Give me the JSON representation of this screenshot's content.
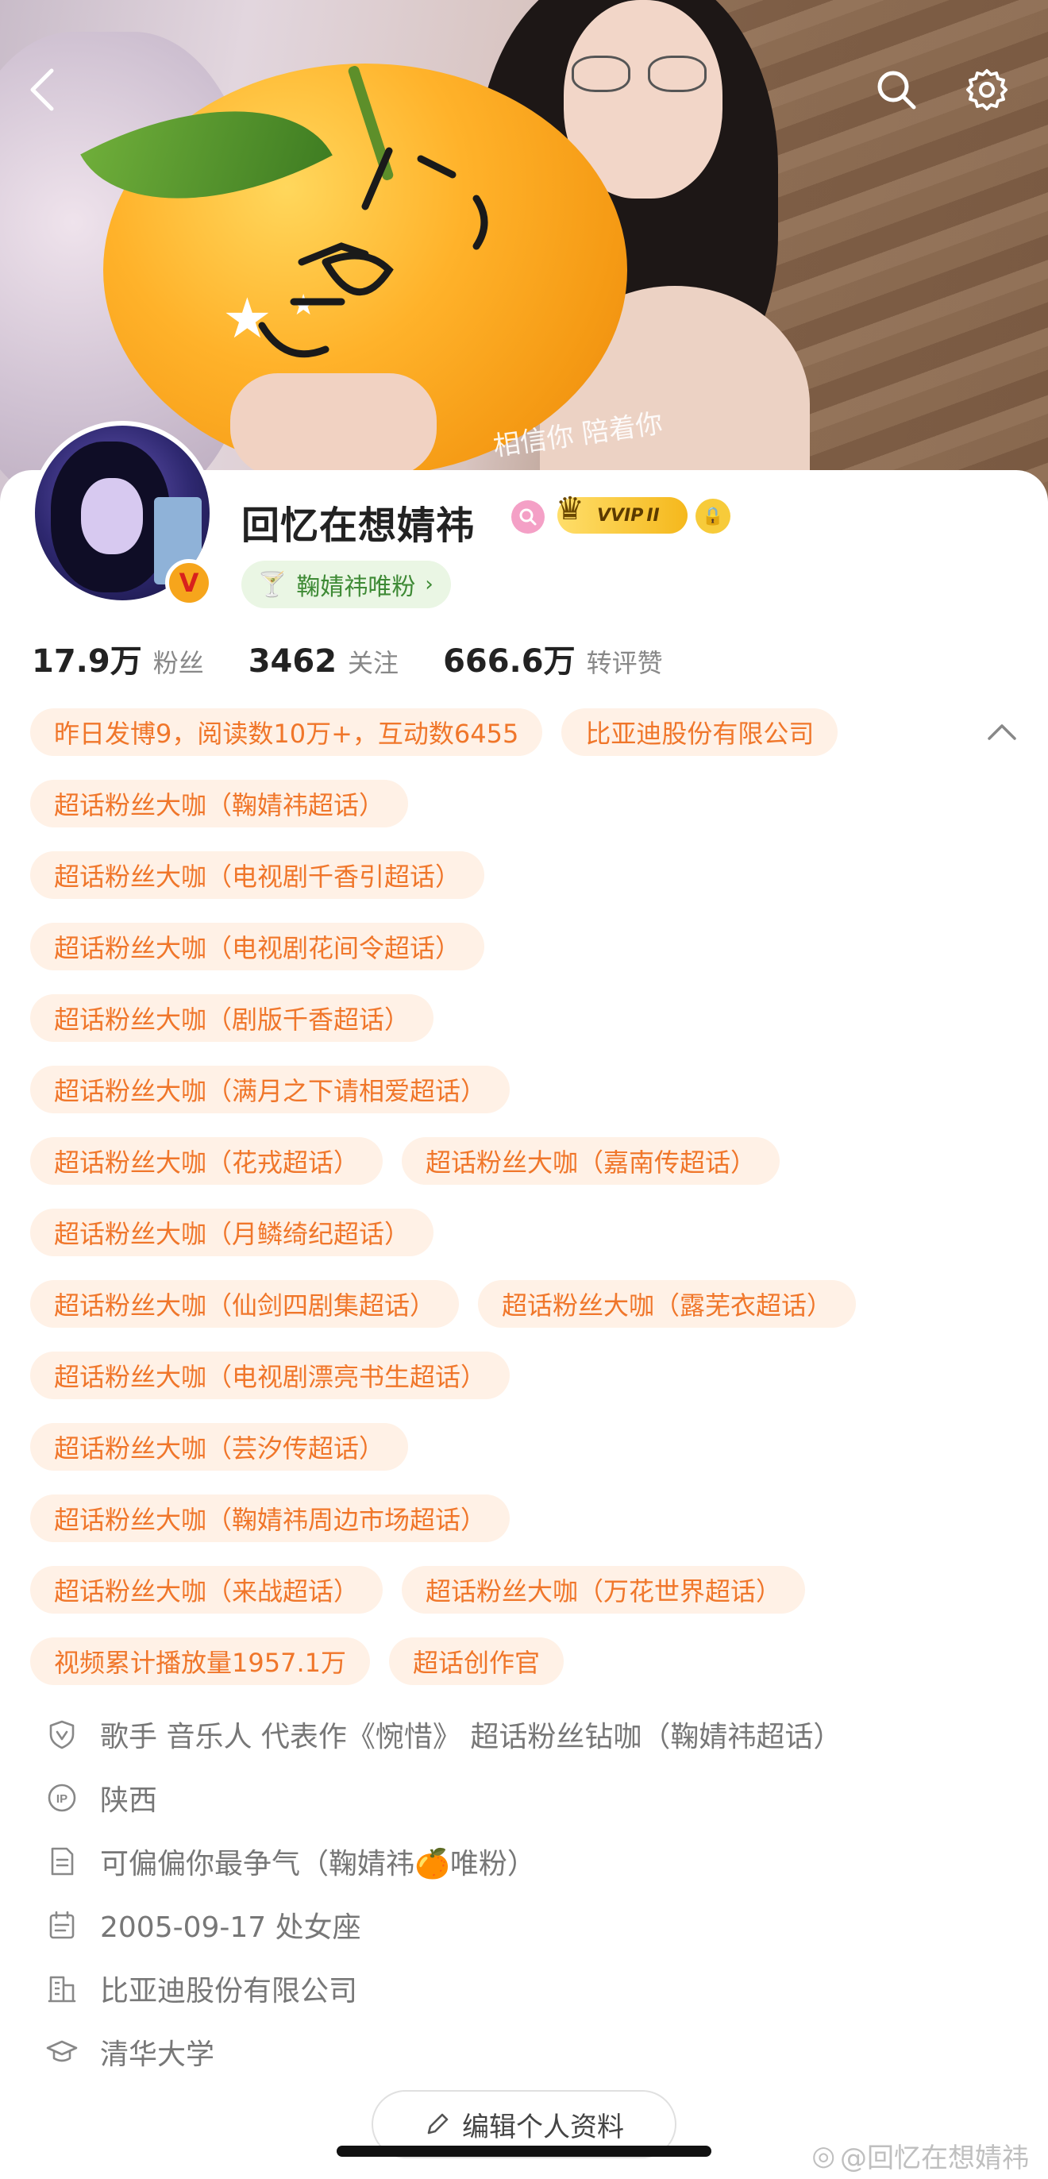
{
  "header": {
    "back_icon": "chevron-left-icon",
    "search_icon": "search-icon",
    "settings_icon": "gear-icon"
  },
  "banner": {
    "handwriting": "相信你 陪着你"
  },
  "profile": {
    "name": "回忆在想婧祎",
    "vip_label": "VVIP",
    "vip_level": "II",
    "verified_badge": "V",
    "fan_badge": "鞠婧祎唯粉",
    "stats": [
      {
        "value": "17.9万",
        "label": "粉丝"
      },
      {
        "value": "3462",
        "label": "关注"
      },
      {
        "value": "666.6万",
        "label": "转评赞"
      }
    ]
  },
  "tags": {
    "rows": [
      [
        "昨日发博9，阅读数10万+，互动数6455",
        "比亚迪股份有限公司"
      ],
      [
        "超话粉丝大咖（鞠婧祎超话）"
      ],
      [
        "超话粉丝大咖（电视剧千香引超话）"
      ],
      [
        "超话粉丝大咖（电视剧花间令超话）"
      ],
      [
        "超话粉丝大咖（剧版千香超话）"
      ],
      [
        "超话粉丝大咖（满月之下请相爱超话）"
      ],
      [
        "超话粉丝大咖（花戎超话）",
        "超话粉丝大咖（嘉南传超话）"
      ],
      [
        "超话粉丝大咖（月鳞绮纪超话）"
      ],
      [
        "超话粉丝大咖（仙剑四剧集超话）",
        "超话粉丝大咖（露芜衣超话）"
      ],
      [
        "超话粉丝大咖（电视剧漂亮书生超话）"
      ],
      [
        "超话粉丝大咖（芸汐传超话）"
      ],
      [
        "超话粉丝大咖（鞠婧祎周边市场超话）"
      ],
      [
        "超话粉丝大咖（来战超话）",
        "超话粉丝大咖（万花世界超话）"
      ],
      [
        "视频累计播放量1957.1万",
        "超话创作官"
      ]
    ]
  },
  "info": [
    {
      "icon": "shield-v-icon",
      "text": "歌手 音乐人 代表作《惋惜》 超话粉丝钻咖（鞠婧祎超话）"
    },
    {
      "icon": "ip-location-icon",
      "text": "陕西"
    },
    {
      "icon": "document-icon",
      "text": "可偏偏你最争气（鞠婧祎🍊唯粉）"
    },
    {
      "icon": "calendar-icon",
      "text": "2005-09-17 处女座"
    },
    {
      "icon": "company-icon",
      "text": "比亚迪股份有限公司"
    },
    {
      "icon": "graduation-cap-icon",
      "text": "清华大学"
    }
  ],
  "edit_button": "编辑个人资料",
  "watermark": "@回忆在想婧祎",
  "colors": {
    "tag_bg": "#fff1e6",
    "tag_text": "#f0762a",
    "fan_badge_bg": "#eaf6e4",
    "fan_badge_text": "#3e8a35"
  }
}
